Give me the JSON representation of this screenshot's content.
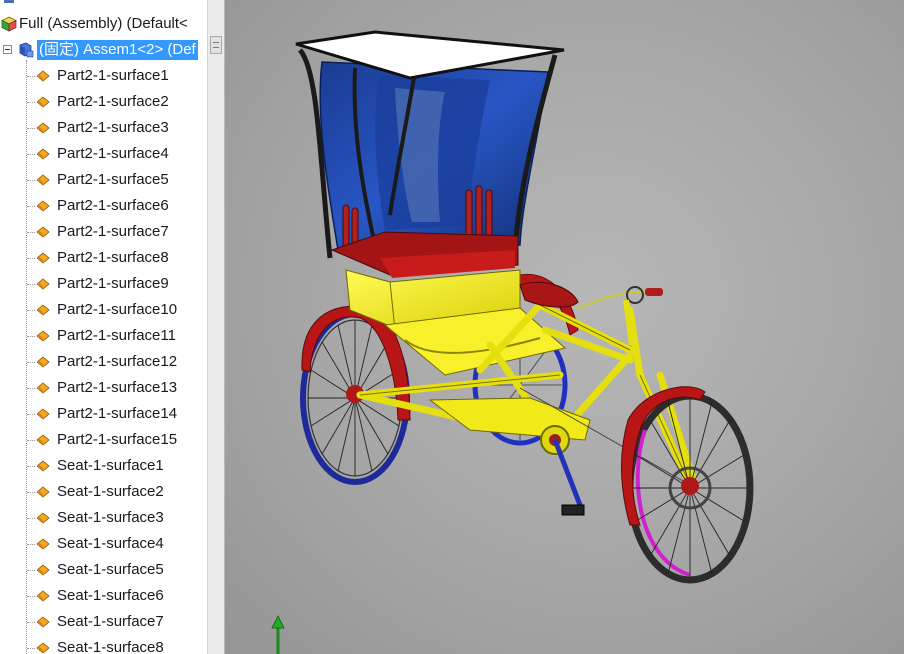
{
  "feature_tree": {
    "root_label": "Full (Assembly)  (Default<",
    "subassembly_label": "(固定) Assem1<2> (Def",
    "items": [
      {
        "label": "Part2-1-surface1"
      },
      {
        "label": "Part2-1-surface2"
      },
      {
        "label": "Part2-1-surface3"
      },
      {
        "label": "Part2-1-surface4"
      },
      {
        "label": "Part2-1-surface5"
      },
      {
        "label": "Part2-1-surface6"
      },
      {
        "label": "Part2-1-surface7"
      },
      {
        "label": "Part2-1-surface8"
      },
      {
        "label": "Part2-1-surface9"
      },
      {
        "label": "Part2-1-surface10"
      },
      {
        "label": "Part2-1-surface11"
      },
      {
        "label": "Part2-1-surface12"
      },
      {
        "label": "Part2-1-surface13"
      },
      {
        "label": "Part2-1-surface14"
      },
      {
        "label": "Part2-1-surface15"
      },
      {
        "label": "Seat-1-surface1"
      },
      {
        "label": "Seat-1-surface2"
      },
      {
        "label": "Seat-1-surface3"
      },
      {
        "label": "Seat-1-surface4"
      },
      {
        "label": "Seat-1-surface5"
      },
      {
        "label": "Seat-1-surface6"
      },
      {
        "label": "Seat-1-surface7"
      },
      {
        "label": "Seat-1-surface8"
      }
    ],
    "icons": {
      "root": "assembly-icon",
      "subassembly": "subassembly-icon",
      "item": "surface-body-icon"
    }
  },
  "colors": {
    "selection": "#3399ff",
    "viewport_bg": "#a8a8a8",
    "frame_yellow": "#f2ec1a",
    "canopy_blue": "#1c3f9a",
    "fender_red": "#b31515",
    "rim_blue": "#2030d0",
    "rim_magenta": "#d020d0"
  }
}
